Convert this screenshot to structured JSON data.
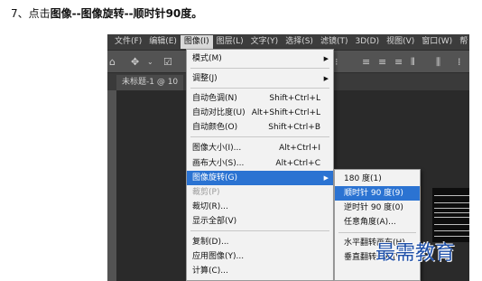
{
  "instruction": {
    "prefix": "7、点击",
    "path": "图像--图像旋转--顺时针90度。"
  },
  "menubar": {
    "items": [
      "文件(F)",
      "编辑(E)",
      "图像(I)",
      "图层(L)",
      "文字(Y)",
      "选择(S)",
      "滤镜(T)",
      "3D(D)",
      "视图(V)",
      "窗口(W)",
      "帮"
    ]
  },
  "document": {
    "tab": "未标题-1 @ 10"
  },
  "image_menu": {
    "items": [
      {
        "label": "模式(M)",
        "shortcut": "",
        "submenu": true
      },
      {
        "label": "调整(J)",
        "shortcut": "",
        "submenu": true
      },
      {
        "label": "自动色调(N)",
        "shortcut": "Shift+Ctrl+L"
      },
      {
        "label": "自动对比度(U)",
        "shortcut": "Alt+Shift+Ctrl+L"
      },
      {
        "label": "自动颜色(O)",
        "shortcut": "Shift+Ctrl+B"
      },
      {
        "label": "图像大小(I)...",
        "shortcut": "Alt+Ctrl+I"
      },
      {
        "label": "画布大小(S)...",
        "shortcut": "Alt+Ctrl+C"
      },
      {
        "label": "图像旋转(G)",
        "shortcut": "",
        "submenu": true
      },
      {
        "label": "裁剪(P)",
        "shortcut": ""
      },
      {
        "label": "裁切(R)...",
        "shortcut": ""
      },
      {
        "label": "显示全部(V)",
        "shortcut": ""
      },
      {
        "label": "复制(D)...",
        "shortcut": ""
      },
      {
        "label": "应用图像(Y)...",
        "shortcut": ""
      },
      {
        "label": "计算(C)...",
        "shortcut": ""
      }
    ]
  },
  "rotate_submenu": {
    "items": [
      "180 度(1)",
      "顺时针 90 度(9)",
      "逆时针 90 度(0)",
      "任意角度(A)...",
      "水平翻转画布(H)",
      "垂直翻转画布(V)"
    ]
  },
  "watermark": "最需教育",
  "colors": {
    "highlight": "#2b73d2",
    "menu_bg": "#f2f2f2",
    "app_bg": "#3c3c3c"
  }
}
